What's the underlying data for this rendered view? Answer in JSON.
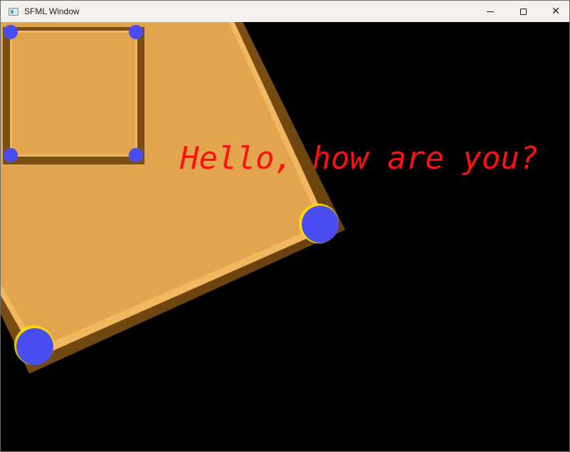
{
  "window": {
    "title": "SFML Window",
    "controls": {
      "minimize": "minimize-icon",
      "maximize": "maximize-icon",
      "close": "close-icon"
    }
  },
  "scene": {
    "text": "Hello, how are you?",
    "text_color": "#ff0000",
    "panel_fill": "#e2a44d",
    "panel_frame": "#7a4e12",
    "handle_color": "#4a4ef0"
  }
}
